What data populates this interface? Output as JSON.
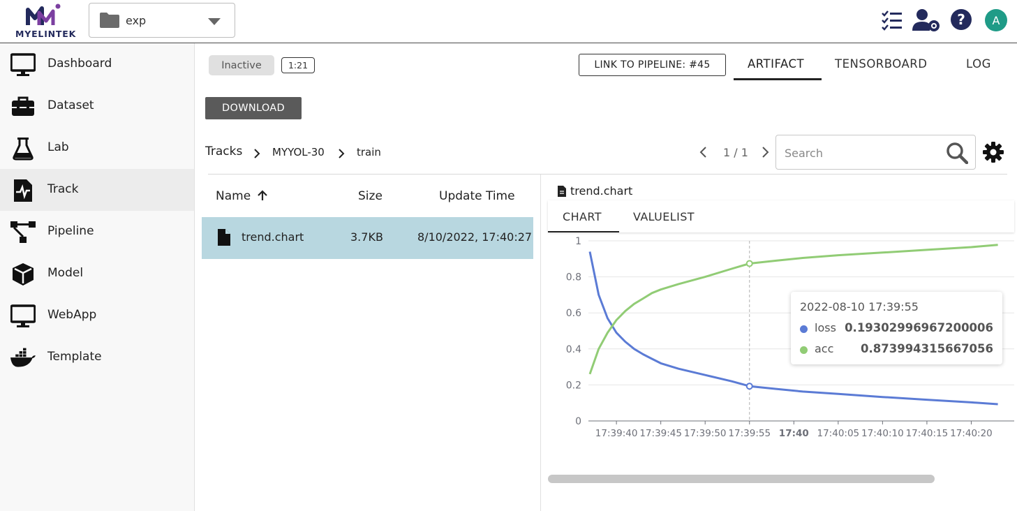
{
  "app": {
    "logo_text": "MYELINTEK",
    "project": "exp",
    "avatar_letter": "A"
  },
  "sidebar": {
    "items": [
      {
        "label": "Dashboard",
        "icon": "monitor-icon"
      },
      {
        "label": "Dataset",
        "icon": "toolbox-icon"
      },
      {
        "label": "Lab",
        "icon": "flask-icon"
      },
      {
        "label": "Track",
        "icon": "track-icon",
        "active": true
      },
      {
        "label": "Pipeline",
        "icon": "pipeline-icon"
      },
      {
        "label": "Model",
        "icon": "cube-icon"
      },
      {
        "label": "WebApp",
        "icon": "monitor-icon"
      },
      {
        "label": "Template",
        "icon": "docker-icon"
      }
    ]
  },
  "header": {
    "status": "Inactive",
    "duration": "1:21",
    "link_pipeline": "LINK TO PIPELINE: #45",
    "tabs": [
      {
        "label": "ARTIFACT",
        "active": true
      },
      {
        "label": "TENSORBOARD"
      },
      {
        "label": "LOG"
      }
    ],
    "download": "DOWNLOAD"
  },
  "breadcrumb": {
    "root": "Tracks",
    "items": [
      "MYYOL-30",
      "train"
    ]
  },
  "pager": {
    "text": "1 / 1"
  },
  "search": {
    "placeholder": "Search"
  },
  "table": {
    "columns": [
      "Name",
      "Size",
      "Update Time"
    ],
    "rows": [
      {
        "name": "trend.chart",
        "size": "3.7KB",
        "updated": "8/10/2022, 17:40:27"
      }
    ]
  },
  "panel": {
    "title": "trend.chart",
    "tabs": [
      {
        "label": "CHART",
        "active": true
      },
      {
        "label": "VALUELIST"
      }
    ]
  },
  "colors": {
    "loss": "#5b7bd5",
    "acc": "#91cc75",
    "selected_row": "#b8d7e0"
  },
  "chart_data": {
    "type": "line",
    "ylim": [
      0,
      1
    ],
    "yticks": [
      "0",
      "0.2",
      "0.4",
      "0.6",
      "0.8",
      "1"
    ],
    "xticks": [
      "17:39:40",
      "17:39:45",
      "17:39:50",
      "17:39:55",
      "17:40",
      "17:40:05",
      "17:40:10",
      "17:40:15",
      "17:40:20"
    ],
    "x": [
      "17:39:37",
      "17:39:38",
      "17:39:39",
      "17:39:40",
      "17:39:41",
      "17:39:42",
      "17:39:43",
      "17:39:44",
      "17:39:45",
      "17:39:47",
      "17:39:50",
      "17:39:53",
      "17:39:55",
      "17:39:58",
      "17:40:01",
      "17:40:05",
      "17:40:10",
      "17:40:15",
      "17:40:20",
      "17:40:23"
    ],
    "series": [
      {
        "name": "loss",
        "values": [
          0.94,
          0.7,
          0.57,
          0.49,
          0.44,
          0.4,
          0.37,
          0.345,
          0.32,
          0.29,
          0.255,
          0.22,
          0.193,
          0.178,
          0.163,
          0.15,
          0.133,
          0.118,
          0.103,
          0.093
        ]
      },
      {
        "name": "acc",
        "values": [
          0.26,
          0.4,
          0.49,
          0.56,
          0.61,
          0.65,
          0.68,
          0.71,
          0.73,
          0.76,
          0.8,
          0.845,
          0.874,
          0.89,
          0.905,
          0.92,
          0.935,
          0.95,
          0.965,
          0.978
        ]
      }
    ],
    "tooltip": {
      "title": "2022-08-10 17:39:55",
      "rows": [
        {
          "name": "loss",
          "value": "0.19302996967200006"
        },
        {
          "name": "acc",
          "value": "0.873994315667056"
        }
      ]
    }
  }
}
